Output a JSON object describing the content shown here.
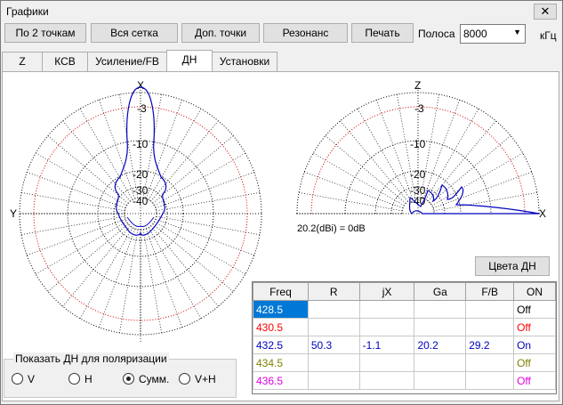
{
  "window": {
    "title": "Графики",
    "close": "✕"
  },
  "toolbar": {
    "btn_2points": "По 2 точкам",
    "btn_grid": "Вся сетка",
    "btn_extra": "Доп. точки",
    "btn_resonance": "Резонанс",
    "btn_print": "Печать",
    "band_label": "Полоса",
    "band_value": "8000",
    "band_unit": "кГц"
  },
  "tabs": [
    "Z",
    "КСВ",
    "Усиление/FB",
    "ДН",
    "Установки"
  ],
  "active_tab": "ДН",
  "plot_left": {
    "top_label": "X",
    "left_label": "Y",
    "rings": [
      "-3",
      "-10",
      "-20",
      "-30",
      "-40"
    ]
  },
  "plot_right": {
    "top_label": "Z",
    "right_label": "X",
    "rings": [
      "-3",
      "-10",
      "-20",
      "-30",
      "-40"
    ],
    "note": "20.2(dBi) = 0dB"
  },
  "colors_button": "Цвета ДН",
  "table": {
    "headers": [
      "Freq",
      "R",
      "jX",
      "Ga",
      "F/B",
      "ON"
    ],
    "rows": [
      {
        "freq": "428.5",
        "r": "",
        "jx": "",
        "ga": "",
        "fb": "",
        "on": "Off",
        "color": "#000000",
        "on_color": "#000000"
      },
      {
        "freq": "430.5",
        "r": "",
        "jx": "",
        "ga": "",
        "fb": "",
        "on": "Off",
        "color": "#ff0000",
        "on_color": "#ff0000"
      },
      {
        "freq": "432.5",
        "r": "50.3",
        "jx": "-1.1",
        "ga": "20.2",
        "fb": "29.2",
        "on": "On",
        "color": "#0000c0",
        "on_color": "#0000c0"
      },
      {
        "freq": "434.5",
        "r": "",
        "jx": "",
        "ga": "",
        "fb": "",
        "on": "Off",
        "color": "#808000",
        "on_color": "#808000"
      },
      {
        "freq": "436.5",
        "r": "",
        "jx": "",
        "ga": "",
        "fb": "",
        "on": "Off",
        "color": "#e000e0",
        "on_color": "#e000e0"
      }
    ]
  },
  "polarization": {
    "title": "Показать ДН для поляризации",
    "options": [
      "V",
      "H",
      "Сумм.",
      "V+H"
    ],
    "selected": "Сумм."
  }
}
